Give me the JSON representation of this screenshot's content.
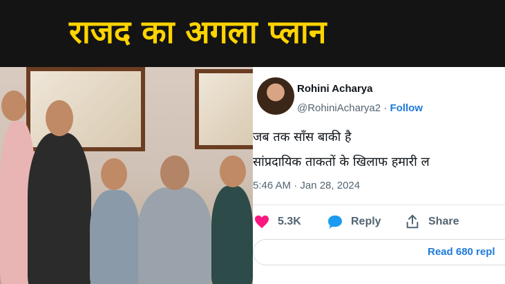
{
  "headline": "राजद का अगला प्लान",
  "tweet": {
    "author_name": "Rohini Acharya",
    "handle": "@RohiniAcharya2",
    "separator": "·",
    "follow_label": "Follow",
    "line1": "जब तक साँस बाकी है",
    "line2": "सांप्रदायिक ताकतों के खिलाफ हमारी ल",
    "timestamp": "5:46 AM · Jan 28, 2024",
    "likes": "5.3K",
    "reply_label": "Reply",
    "share_label": "Share",
    "read_replies": "Read 680 repl"
  },
  "colors": {
    "headline": "#ffd400",
    "link": "#1d7bd8",
    "heart": "#f91880"
  },
  "icons": [
    "heart-icon",
    "reply-bubble-icon",
    "share-icon"
  ]
}
